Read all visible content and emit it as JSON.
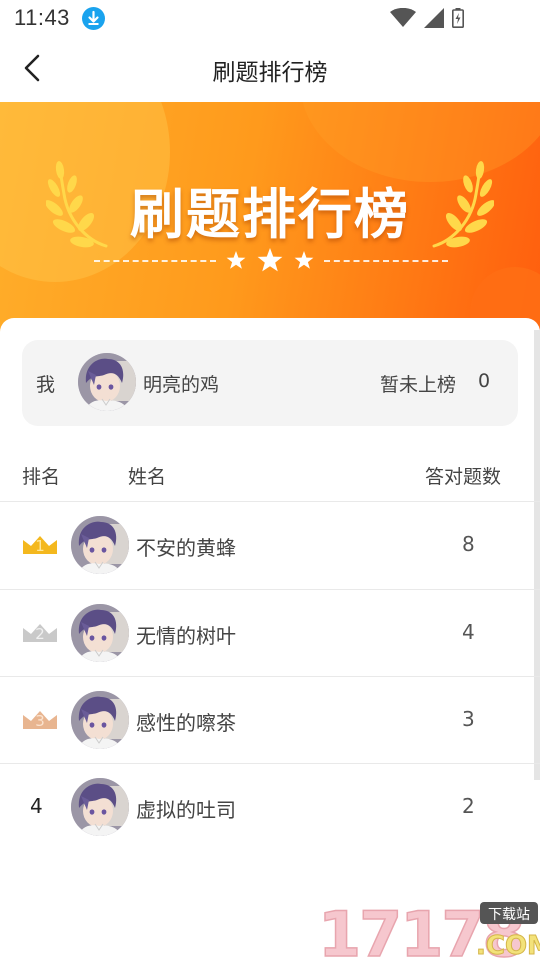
{
  "status_bar": {
    "time": "11:43"
  },
  "nav": {
    "title": "刷题排行榜"
  },
  "banner": {
    "title": "刷题排行榜"
  },
  "me": {
    "label": "我",
    "name": "明亮的鸡",
    "status": "暂未上榜",
    "count": "0"
  },
  "table_header": {
    "rank": "排名",
    "name": "姓名",
    "count": "答对题数"
  },
  "rows": [
    {
      "rank": "1",
      "name": "不安的黄蜂",
      "count": "8"
    },
    {
      "rank": "2",
      "name": "无情的树叶",
      "count": "4"
    },
    {
      "rank": "3",
      "name": "感性的嚓茶",
      "count": "3"
    },
    {
      "rank": "4",
      "name": "虚拟的吐司",
      "count": "2"
    }
  ],
  "colors": {
    "gold": "#f4b81e",
    "silver": "#c9c9c9",
    "bronze": "#e8b590",
    "banner_start": "#ffae2a",
    "banner_end": "#ff5e0e"
  },
  "watermark": {
    "text": "17178",
    "tag": "下载站",
    "domain": ".COM"
  }
}
